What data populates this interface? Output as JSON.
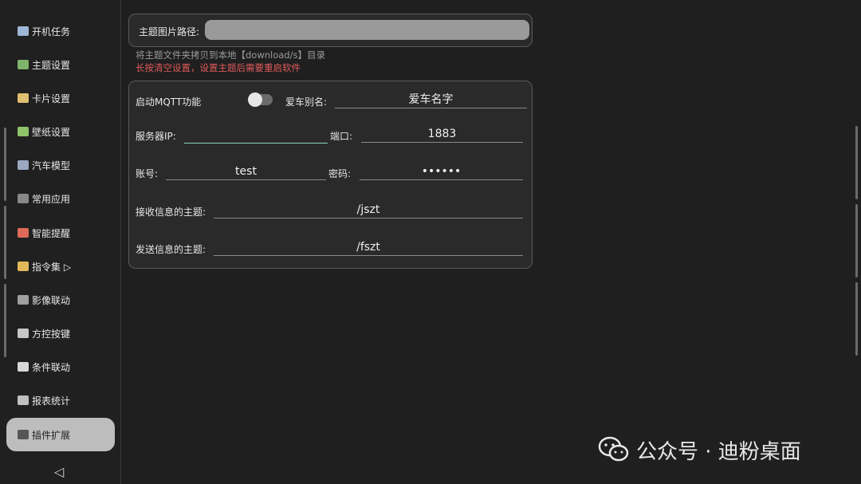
{
  "sidebar": {
    "items": [
      {
        "label": "开机任务",
        "icon": "laptop-icon",
        "color": "#9fb7d6"
      },
      {
        "label": "主题设置",
        "icon": "palette-icon",
        "color": "#7fb56a"
      },
      {
        "label": "卡片设置",
        "icon": "card-icon",
        "color": "#e0c070"
      },
      {
        "label": "壁纸设置",
        "icon": "picture-icon",
        "color": "#8fc36a"
      },
      {
        "label": "汽车模型",
        "icon": "car-icon",
        "color": "#9aa8c0"
      },
      {
        "label": "常用应用",
        "icon": "phone-icon",
        "color": "#888888"
      },
      {
        "label": "智能提醒",
        "icon": "megaphone-icon",
        "color": "#e06a5a"
      },
      {
        "label": "指令集 ▷",
        "icon": "tag-icon",
        "color": "#e3b85a"
      },
      {
        "label": "影像联动",
        "icon": "camera-icon",
        "color": "#a0a0a0"
      },
      {
        "label": "方控按键",
        "icon": "keyboard-icon",
        "color": "#c8c8c8"
      },
      {
        "label": "条件联动",
        "icon": "coffee-icon",
        "color": "#d8d8d8"
      },
      {
        "label": "报表统计",
        "icon": "chart-icon",
        "color": "#c0c0c0"
      },
      {
        "label": "插件扩展",
        "icon": "plug-icon",
        "color": "#555555"
      }
    ],
    "active_index": 12,
    "back_icon": "◁"
  },
  "theme": {
    "path_label": "主题图片路径:",
    "path_value": "",
    "hint": "将主题文件夹拷贝到本地【download/s】目录",
    "warning": "长按清空设置，设置主题后需要重启软件",
    "hint_color": "#9a9a9a",
    "warning_color": "#e05a5a"
  },
  "mqtt": {
    "enable_label": "启动MQTT功能",
    "enabled": false,
    "alias_label": "爱车别名:",
    "alias_value": "爱车名字",
    "server_label": "服务器IP:",
    "server_value": "",
    "port_label": "端口:",
    "port_value": "1883",
    "account_label": "账号:",
    "account_value": "test",
    "password_label": "密码:",
    "password_value": "••••••",
    "receive_label": "接收信息的主题:",
    "receive_value": "/jszt",
    "send_label": "发送信息的主题:",
    "send_value": "/fszt"
  },
  "watermark": {
    "text": "公众号 · 迪粉桌面"
  }
}
